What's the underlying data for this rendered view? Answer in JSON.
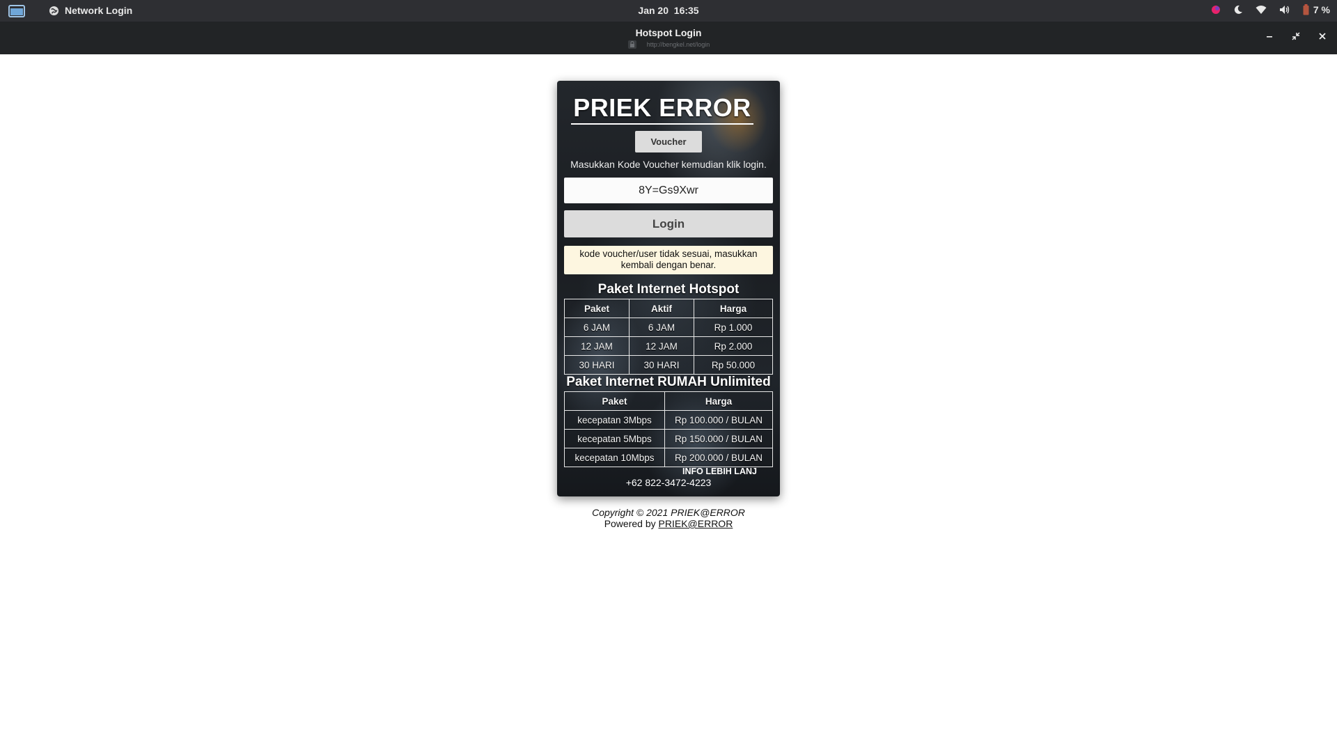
{
  "topbar": {
    "app_name": "Network Login",
    "date": "Jan 20",
    "time": "16:35",
    "battery_percent": "7 %"
  },
  "window": {
    "title": "Hotspot Login",
    "url": "http://bengkel.net/login"
  },
  "card": {
    "brand": "PRIEK ERROR",
    "tab_label": "Voucher",
    "hint": "Masukkan Kode Voucher kemudian klik login.",
    "voucher_value": "8Y=Gs9Xwr",
    "login_label": "Login",
    "error_message": "kode voucher/user tidak sesuai, masukkan kembali dengan benar.",
    "hotspot": {
      "title": "Paket Internet Hotspot",
      "headers": [
        "Paket",
        "Aktif",
        "Harga"
      ],
      "rows": [
        [
          "6 JAM",
          "6 JAM",
          "Rp 1.000"
        ],
        [
          "12 JAM",
          "12 JAM",
          "Rp 2.000"
        ],
        [
          "30 HARI",
          "30 HARI",
          "Rp 50.000"
        ]
      ]
    },
    "rumah": {
      "title": "Paket Internet RUMAH Unlimited",
      "headers": [
        "Paket",
        "Harga"
      ],
      "rows": [
        [
          "kecepatan 3Mbps",
          "Rp 100.000 / BULAN"
        ],
        [
          "kecepatan 5Mbps",
          "Rp 150.000 / BULAN"
        ],
        [
          "kecepatan 10Mbps",
          "Rp 200.000 / BULAN"
        ]
      ]
    },
    "info_label": "INFO LEBIH LANJ",
    "phone": "+62 822-3472-4223"
  },
  "footer": {
    "copyright": "Copyright © 2021 PRIEK@ERROR",
    "powered_prefix": "Powered by ",
    "powered_link": "PRIEK@ERROR"
  },
  "colors": {
    "topbar_bg": "#2e2f33",
    "titlebar_bg": "#222426",
    "error_bg": "#fdf6e0"
  }
}
